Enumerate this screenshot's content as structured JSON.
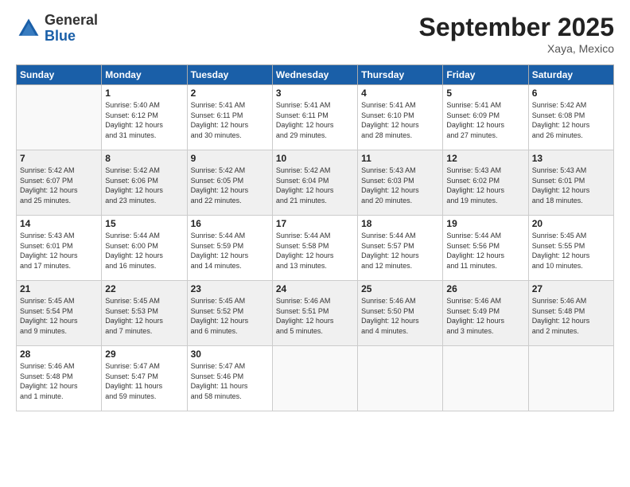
{
  "logo": {
    "general": "General",
    "blue": "Blue"
  },
  "title": "September 2025",
  "location": "Xaya, Mexico",
  "days_header": [
    "Sunday",
    "Monday",
    "Tuesday",
    "Wednesday",
    "Thursday",
    "Friday",
    "Saturday"
  ],
  "weeks": [
    [
      {
        "day": "",
        "info": ""
      },
      {
        "day": "1",
        "info": "Sunrise: 5:40 AM\nSunset: 6:12 PM\nDaylight: 12 hours\nand 31 minutes."
      },
      {
        "day": "2",
        "info": "Sunrise: 5:41 AM\nSunset: 6:11 PM\nDaylight: 12 hours\nand 30 minutes."
      },
      {
        "day": "3",
        "info": "Sunrise: 5:41 AM\nSunset: 6:11 PM\nDaylight: 12 hours\nand 29 minutes."
      },
      {
        "day": "4",
        "info": "Sunrise: 5:41 AM\nSunset: 6:10 PM\nDaylight: 12 hours\nand 28 minutes."
      },
      {
        "day": "5",
        "info": "Sunrise: 5:41 AM\nSunset: 6:09 PM\nDaylight: 12 hours\nand 27 minutes."
      },
      {
        "day": "6",
        "info": "Sunrise: 5:42 AM\nSunset: 6:08 PM\nDaylight: 12 hours\nand 26 minutes."
      }
    ],
    [
      {
        "day": "7",
        "info": "Sunrise: 5:42 AM\nSunset: 6:07 PM\nDaylight: 12 hours\nand 25 minutes."
      },
      {
        "day": "8",
        "info": "Sunrise: 5:42 AM\nSunset: 6:06 PM\nDaylight: 12 hours\nand 23 minutes."
      },
      {
        "day": "9",
        "info": "Sunrise: 5:42 AM\nSunset: 6:05 PM\nDaylight: 12 hours\nand 22 minutes."
      },
      {
        "day": "10",
        "info": "Sunrise: 5:42 AM\nSunset: 6:04 PM\nDaylight: 12 hours\nand 21 minutes."
      },
      {
        "day": "11",
        "info": "Sunrise: 5:43 AM\nSunset: 6:03 PM\nDaylight: 12 hours\nand 20 minutes."
      },
      {
        "day": "12",
        "info": "Sunrise: 5:43 AM\nSunset: 6:02 PM\nDaylight: 12 hours\nand 19 minutes."
      },
      {
        "day": "13",
        "info": "Sunrise: 5:43 AM\nSunset: 6:01 PM\nDaylight: 12 hours\nand 18 minutes."
      }
    ],
    [
      {
        "day": "14",
        "info": "Sunrise: 5:43 AM\nSunset: 6:01 PM\nDaylight: 12 hours\nand 17 minutes."
      },
      {
        "day": "15",
        "info": "Sunrise: 5:44 AM\nSunset: 6:00 PM\nDaylight: 12 hours\nand 16 minutes."
      },
      {
        "day": "16",
        "info": "Sunrise: 5:44 AM\nSunset: 5:59 PM\nDaylight: 12 hours\nand 14 minutes."
      },
      {
        "day": "17",
        "info": "Sunrise: 5:44 AM\nSunset: 5:58 PM\nDaylight: 12 hours\nand 13 minutes."
      },
      {
        "day": "18",
        "info": "Sunrise: 5:44 AM\nSunset: 5:57 PM\nDaylight: 12 hours\nand 12 minutes."
      },
      {
        "day": "19",
        "info": "Sunrise: 5:44 AM\nSunset: 5:56 PM\nDaylight: 12 hours\nand 11 minutes."
      },
      {
        "day": "20",
        "info": "Sunrise: 5:45 AM\nSunset: 5:55 PM\nDaylight: 12 hours\nand 10 minutes."
      }
    ],
    [
      {
        "day": "21",
        "info": "Sunrise: 5:45 AM\nSunset: 5:54 PM\nDaylight: 12 hours\nand 9 minutes."
      },
      {
        "day": "22",
        "info": "Sunrise: 5:45 AM\nSunset: 5:53 PM\nDaylight: 12 hours\nand 7 minutes."
      },
      {
        "day": "23",
        "info": "Sunrise: 5:45 AM\nSunset: 5:52 PM\nDaylight: 12 hours\nand 6 minutes."
      },
      {
        "day": "24",
        "info": "Sunrise: 5:46 AM\nSunset: 5:51 PM\nDaylight: 12 hours\nand 5 minutes."
      },
      {
        "day": "25",
        "info": "Sunrise: 5:46 AM\nSunset: 5:50 PM\nDaylight: 12 hours\nand 4 minutes."
      },
      {
        "day": "26",
        "info": "Sunrise: 5:46 AM\nSunset: 5:49 PM\nDaylight: 12 hours\nand 3 minutes."
      },
      {
        "day": "27",
        "info": "Sunrise: 5:46 AM\nSunset: 5:48 PM\nDaylight: 12 hours\nand 2 minutes."
      }
    ],
    [
      {
        "day": "28",
        "info": "Sunrise: 5:46 AM\nSunset: 5:48 PM\nDaylight: 12 hours\nand 1 minute."
      },
      {
        "day": "29",
        "info": "Sunrise: 5:47 AM\nSunset: 5:47 PM\nDaylight: 11 hours\nand 59 minutes."
      },
      {
        "day": "30",
        "info": "Sunrise: 5:47 AM\nSunset: 5:46 PM\nDaylight: 11 hours\nand 58 minutes."
      },
      {
        "day": "",
        "info": ""
      },
      {
        "day": "",
        "info": ""
      },
      {
        "day": "",
        "info": ""
      },
      {
        "day": "",
        "info": ""
      }
    ]
  ]
}
